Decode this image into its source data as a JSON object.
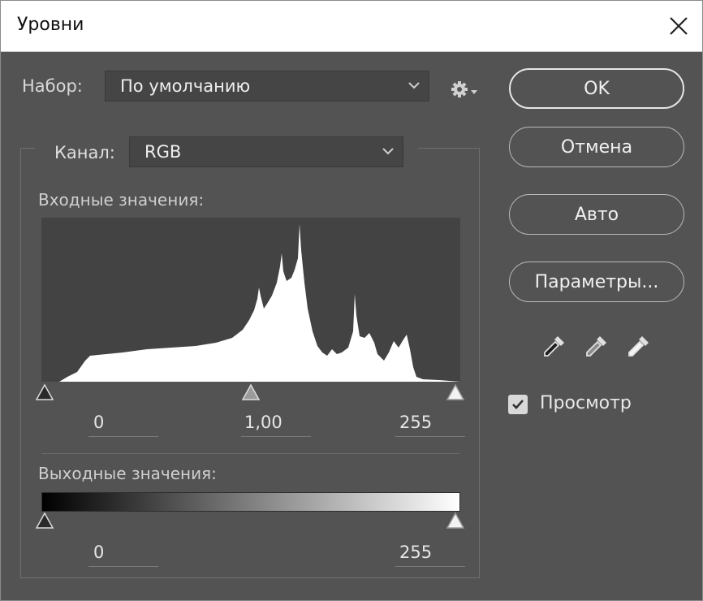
{
  "window": {
    "title": "Уровни"
  },
  "preset": {
    "label": "Набор:",
    "value": "По умолчанию"
  },
  "channel": {
    "label": "Канал:",
    "value": "RGB"
  },
  "input": {
    "label": "Входные значения:",
    "black": "0",
    "gamma": "1,00",
    "white": "255"
  },
  "output": {
    "label": "Выходные значения:",
    "black": "0",
    "white": "255"
  },
  "buttons": {
    "ok": "OK",
    "cancel": "Отмена",
    "auto": "Авто",
    "options": "Параметры..."
  },
  "preview": {
    "label": "Просмотр",
    "checked": true
  },
  "icons": {
    "close": "close-icon",
    "gear": "gear-icon",
    "chevron": "chevron-down-icon",
    "droppers": [
      "black-point-eyedropper-icon",
      "gray-point-eyedropper-icon",
      "white-point-eyedropper-icon"
    ]
  },
  "colors": {
    "panel": "#535353",
    "field": "#454545",
    "histogram_bg": "#434343",
    "histogram_fill": "#ffffff"
  }
}
